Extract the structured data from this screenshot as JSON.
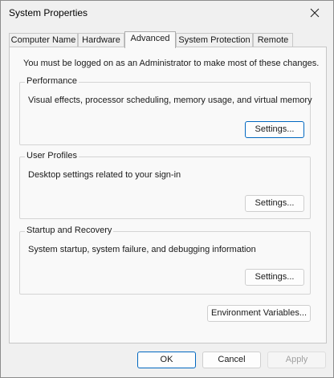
{
  "window": {
    "title": "System Properties"
  },
  "tabs": [
    {
      "label": "Computer Name"
    },
    {
      "label": "Hardware"
    },
    {
      "label": "Advanced"
    },
    {
      "label": "System Protection"
    },
    {
      "label": "Remote"
    }
  ],
  "active_tab": "Advanced",
  "admin_note": "You must be logged on as an Administrator to make most of these changes.",
  "groups": {
    "performance": {
      "label": "Performance",
      "description": "Visual effects, processor scheduling, memory usage, and virtual memory",
      "button_label": "Settings..."
    },
    "user_profiles": {
      "label": "User Profiles",
      "description": "Desktop settings related to your sign-in",
      "button_label": "Settings..."
    },
    "startup_recovery": {
      "label": "Startup and Recovery",
      "description": "System startup, system failure, and debugging information",
      "button_label": "Settings..."
    }
  },
  "env_button_label": "Environment Variables...",
  "footer": {
    "ok_label": "OK",
    "cancel_label": "Cancel",
    "apply_label": "Apply"
  },
  "colors": {
    "accent": "#0067c0",
    "window_bg": "#f0f0f0",
    "panel_bg": "#f9f9f9"
  }
}
